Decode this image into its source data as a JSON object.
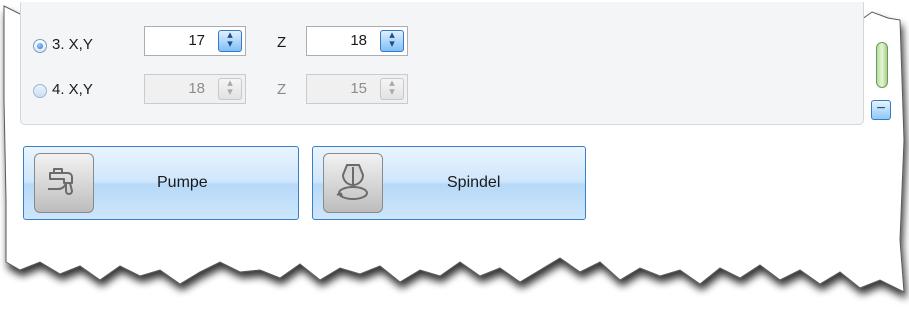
{
  "coordinates": {
    "rows": [
      {
        "label": "3. X,Y",
        "selected": true,
        "enabled": true,
        "xy_value": "17",
        "z_label": "Z",
        "z_value": "18"
      },
      {
        "label": "4. X,Y",
        "selected": false,
        "enabled": false,
        "xy_value": "18",
        "z_label": "Z",
        "z_value": "15"
      }
    ]
  },
  "scrollbar": {
    "decrease_label": "−"
  },
  "buttons": {
    "pump_label": "Pumpe",
    "pump_icon": "faucet-icon",
    "spindle_label": "Spindel",
    "spindle_icon": "spindle-icon"
  },
  "colors": {
    "accent": "#3c7fc9",
    "button_fill": "#cfe6fb",
    "panel": "#f4f5f7"
  }
}
